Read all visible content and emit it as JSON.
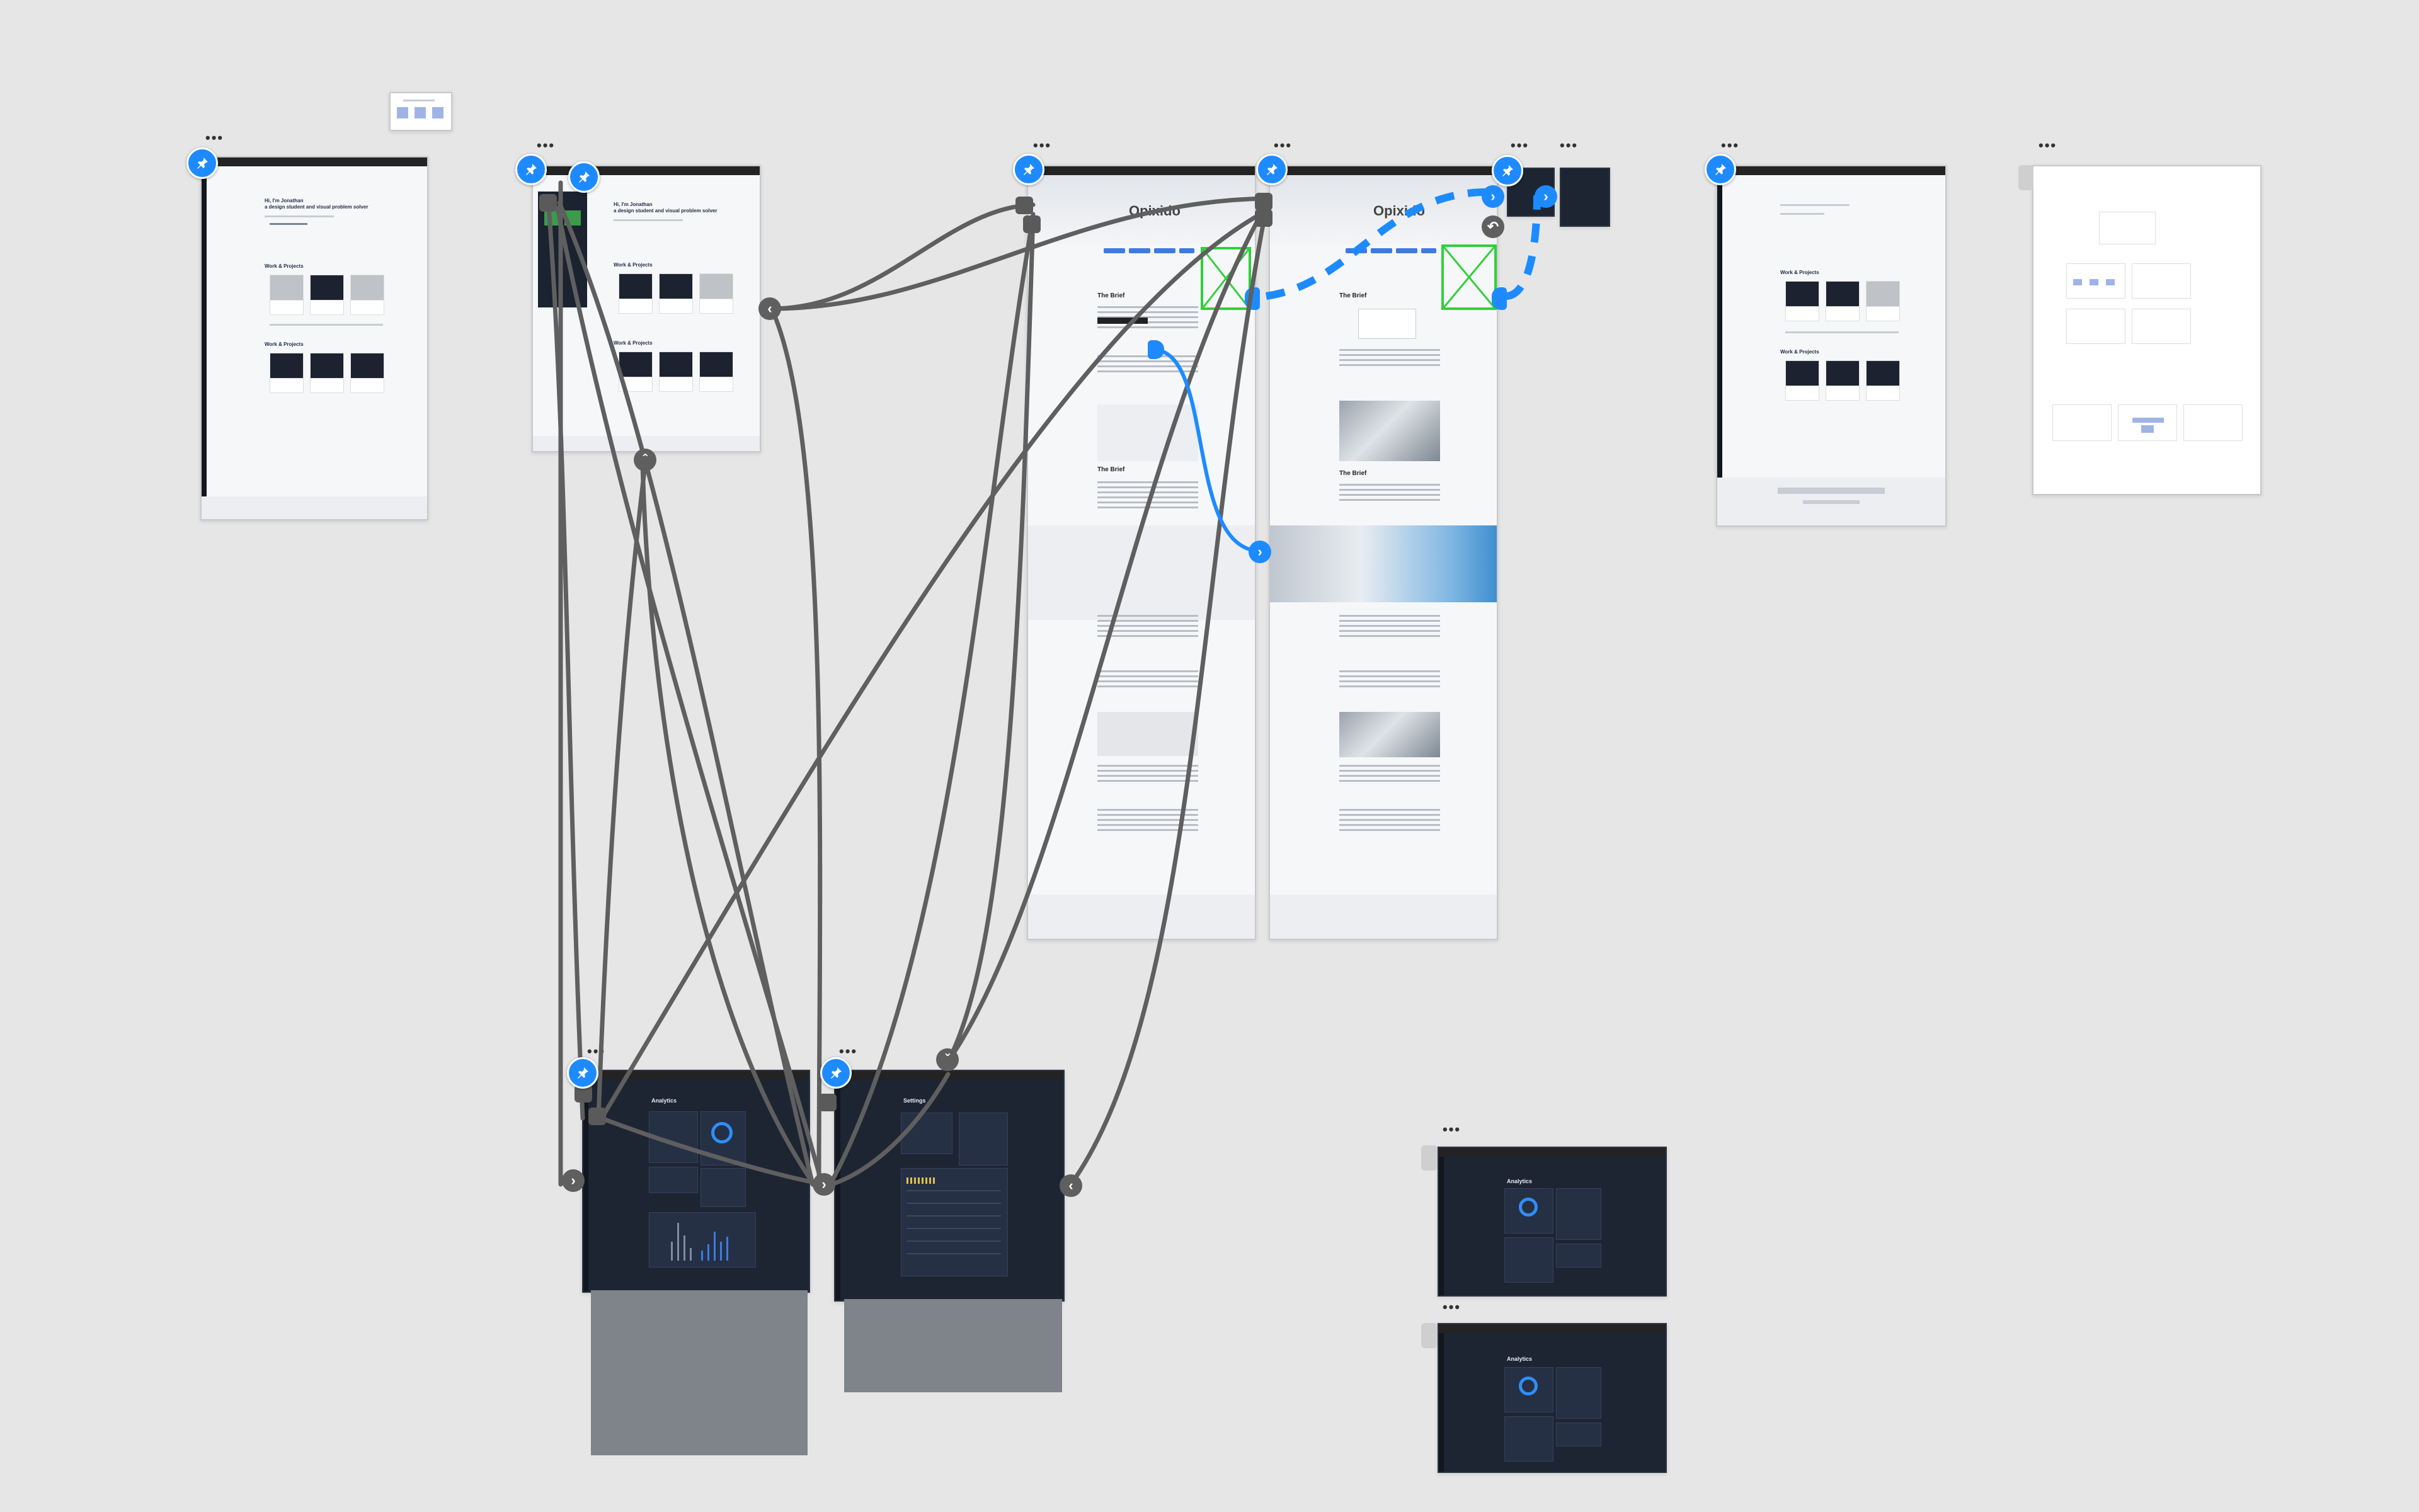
{
  "canvas": {
    "title": "",
    "icons": {
      "more": "ellipsis-icon",
      "pin": "pin-icon",
      "prev": "chevron-left-icon",
      "next": "chevron-right-icon",
      "up": "chevron-up-icon",
      "down": "chevron-down-icon",
      "undo": "undo-icon"
    }
  },
  "frames": {
    "home_a": {
      "hero_line1": "Hi, I'm Jonathan",
      "hero_line2": "a design student and visual problem solver",
      "section1": "Work & Projects",
      "section2": "Work & Projects"
    },
    "home_b": {
      "hero_line1": "Hi, I'm Jonathan",
      "hero_line2": "a design student and visual problem solver",
      "section1": "Work & Projects",
      "section2": "Work & Projects"
    },
    "home_c": {
      "section1": "Work & Projects",
      "section2": "Work & Projects"
    },
    "case_a": {
      "title": "Opixido",
      "brief1": "The Brief",
      "brief2": "The Brief"
    },
    "case_b": {
      "title": "Opixido",
      "brief1": "The Brief",
      "brief2": "The Brief"
    },
    "analytics": {
      "title": "Analytics"
    },
    "settings": {
      "title": "Settings"
    },
    "analytics_small_1": {
      "title": "Analytics"
    },
    "analytics_small_2": {
      "title": "Analytics"
    }
  },
  "colors": {
    "canvas_bg": "#e6e6e6",
    "accent": "#1d8bff",
    "connector": "#5f5f5f",
    "placeholder_green": "#2fd13a",
    "dark_frame": "#1d2533"
  }
}
